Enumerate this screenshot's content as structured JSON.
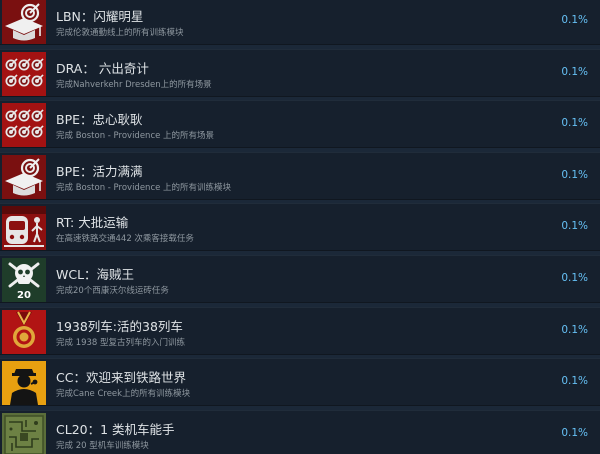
{
  "colors": {
    "background": "#1b2838",
    "row": "#16202d",
    "title_text": "#dfe3e6",
    "desc_text": "#8f98a0",
    "percent_text": "#66c0f4"
  },
  "achievements": [
    {
      "title": "LBN：闪耀明星",
      "desc": "完成伦敦通勤线上的所有训练模块",
      "percent": "0.1%",
      "icon": "graduation-cap-target-icon"
    },
    {
      "title": "DRA： 六出奇计",
      "desc": "完成Nahverkehr Dresden上的所有场景",
      "percent": "0.1%",
      "icon": "six-targets-icon"
    },
    {
      "title": "BPE：忠心耿耿",
      "desc": "完成 Boston - Providence 上的所有场景",
      "percent": "0.1%",
      "icon": "six-targets-icon"
    },
    {
      "title": "BPE：活力满满",
      "desc": "完成 Boston - Providence 上的所有训练模块",
      "percent": "0.1%",
      "icon": "graduation-cap-target-icon"
    },
    {
      "title": "RT: 大批运输",
      "desc": "在高速铁路交通442 次乘客接载任务",
      "percent": "0.1%",
      "icon": "train-passenger-icon"
    },
    {
      "title": "WCL：海贼王",
      "desc": "完成20个西康沃尔线运砖任务",
      "percent": "0.1%",
      "icon": "skull-crossbones-icon",
      "badge": "20"
    },
    {
      "title": "1938列车:活的38列车",
      "desc": "完成 1938 型复古列车的入门训练",
      "percent": "0.1%",
      "icon": "medal-icon"
    },
    {
      "title": "CC：欢迎来到铁路世界",
      "desc": "完成Cane Creek上的所有训练模块",
      "percent": "0.1%",
      "icon": "conductor-icon"
    },
    {
      "title": "CL20：1 类机车能手",
      "desc": "完成 20 型机车训练模块",
      "percent": "0.1%",
      "icon": "circuit-board-icon"
    }
  ]
}
